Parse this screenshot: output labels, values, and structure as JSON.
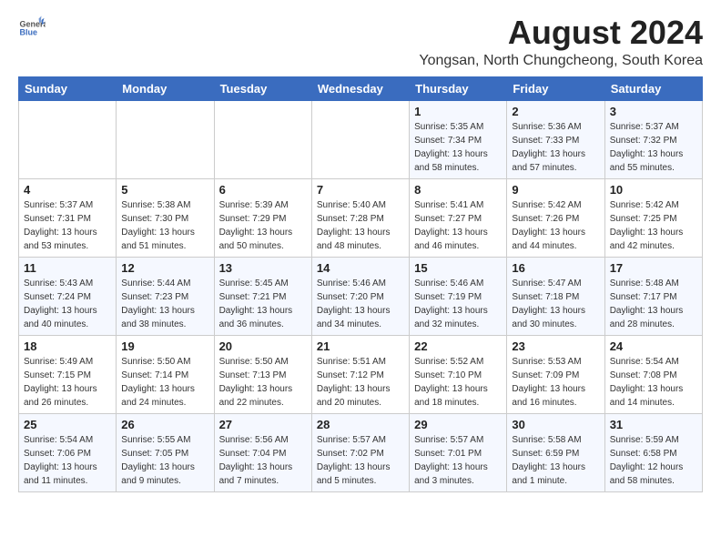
{
  "logo": {
    "general": "General",
    "blue": "Blue"
  },
  "header": {
    "month_year": "August 2024",
    "location": "Yongsan, North Chungcheong, South Korea"
  },
  "weekdays": [
    "Sunday",
    "Monday",
    "Tuesday",
    "Wednesday",
    "Thursday",
    "Friday",
    "Saturday"
  ],
  "weeks": [
    [
      {
        "day": "",
        "info": ""
      },
      {
        "day": "",
        "info": ""
      },
      {
        "day": "",
        "info": ""
      },
      {
        "day": "",
        "info": ""
      },
      {
        "day": "1",
        "info": "Sunrise: 5:35 AM\nSunset: 7:34 PM\nDaylight: 13 hours\nand 58 minutes."
      },
      {
        "day": "2",
        "info": "Sunrise: 5:36 AM\nSunset: 7:33 PM\nDaylight: 13 hours\nand 57 minutes."
      },
      {
        "day": "3",
        "info": "Sunrise: 5:37 AM\nSunset: 7:32 PM\nDaylight: 13 hours\nand 55 minutes."
      }
    ],
    [
      {
        "day": "4",
        "info": "Sunrise: 5:37 AM\nSunset: 7:31 PM\nDaylight: 13 hours\nand 53 minutes."
      },
      {
        "day": "5",
        "info": "Sunrise: 5:38 AM\nSunset: 7:30 PM\nDaylight: 13 hours\nand 51 minutes."
      },
      {
        "day": "6",
        "info": "Sunrise: 5:39 AM\nSunset: 7:29 PM\nDaylight: 13 hours\nand 50 minutes."
      },
      {
        "day": "7",
        "info": "Sunrise: 5:40 AM\nSunset: 7:28 PM\nDaylight: 13 hours\nand 48 minutes."
      },
      {
        "day": "8",
        "info": "Sunrise: 5:41 AM\nSunset: 7:27 PM\nDaylight: 13 hours\nand 46 minutes."
      },
      {
        "day": "9",
        "info": "Sunrise: 5:42 AM\nSunset: 7:26 PM\nDaylight: 13 hours\nand 44 minutes."
      },
      {
        "day": "10",
        "info": "Sunrise: 5:42 AM\nSunset: 7:25 PM\nDaylight: 13 hours\nand 42 minutes."
      }
    ],
    [
      {
        "day": "11",
        "info": "Sunrise: 5:43 AM\nSunset: 7:24 PM\nDaylight: 13 hours\nand 40 minutes."
      },
      {
        "day": "12",
        "info": "Sunrise: 5:44 AM\nSunset: 7:23 PM\nDaylight: 13 hours\nand 38 minutes."
      },
      {
        "day": "13",
        "info": "Sunrise: 5:45 AM\nSunset: 7:21 PM\nDaylight: 13 hours\nand 36 minutes."
      },
      {
        "day": "14",
        "info": "Sunrise: 5:46 AM\nSunset: 7:20 PM\nDaylight: 13 hours\nand 34 minutes."
      },
      {
        "day": "15",
        "info": "Sunrise: 5:46 AM\nSunset: 7:19 PM\nDaylight: 13 hours\nand 32 minutes."
      },
      {
        "day": "16",
        "info": "Sunrise: 5:47 AM\nSunset: 7:18 PM\nDaylight: 13 hours\nand 30 minutes."
      },
      {
        "day": "17",
        "info": "Sunrise: 5:48 AM\nSunset: 7:17 PM\nDaylight: 13 hours\nand 28 minutes."
      }
    ],
    [
      {
        "day": "18",
        "info": "Sunrise: 5:49 AM\nSunset: 7:15 PM\nDaylight: 13 hours\nand 26 minutes."
      },
      {
        "day": "19",
        "info": "Sunrise: 5:50 AM\nSunset: 7:14 PM\nDaylight: 13 hours\nand 24 minutes."
      },
      {
        "day": "20",
        "info": "Sunrise: 5:50 AM\nSunset: 7:13 PM\nDaylight: 13 hours\nand 22 minutes."
      },
      {
        "day": "21",
        "info": "Sunrise: 5:51 AM\nSunset: 7:12 PM\nDaylight: 13 hours\nand 20 minutes."
      },
      {
        "day": "22",
        "info": "Sunrise: 5:52 AM\nSunset: 7:10 PM\nDaylight: 13 hours\nand 18 minutes."
      },
      {
        "day": "23",
        "info": "Sunrise: 5:53 AM\nSunset: 7:09 PM\nDaylight: 13 hours\nand 16 minutes."
      },
      {
        "day": "24",
        "info": "Sunrise: 5:54 AM\nSunset: 7:08 PM\nDaylight: 13 hours\nand 14 minutes."
      }
    ],
    [
      {
        "day": "25",
        "info": "Sunrise: 5:54 AM\nSunset: 7:06 PM\nDaylight: 13 hours\nand 11 minutes."
      },
      {
        "day": "26",
        "info": "Sunrise: 5:55 AM\nSunset: 7:05 PM\nDaylight: 13 hours\nand 9 minutes."
      },
      {
        "day": "27",
        "info": "Sunrise: 5:56 AM\nSunset: 7:04 PM\nDaylight: 13 hours\nand 7 minutes."
      },
      {
        "day": "28",
        "info": "Sunrise: 5:57 AM\nSunset: 7:02 PM\nDaylight: 13 hours\nand 5 minutes."
      },
      {
        "day": "29",
        "info": "Sunrise: 5:57 AM\nSunset: 7:01 PM\nDaylight: 13 hours\nand 3 minutes."
      },
      {
        "day": "30",
        "info": "Sunrise: 5:58 AM\nSunset: 6:59 PM\nDaylight: 13 hours\nand 1 minute."
      },
      {
        "day": "31",
        "info": "Sunrise: 5:59 AM\nSunset: 6:58 PM\nDaylight: 12 hours\nand 58 minutes."
      }
    ]
  ]
}
